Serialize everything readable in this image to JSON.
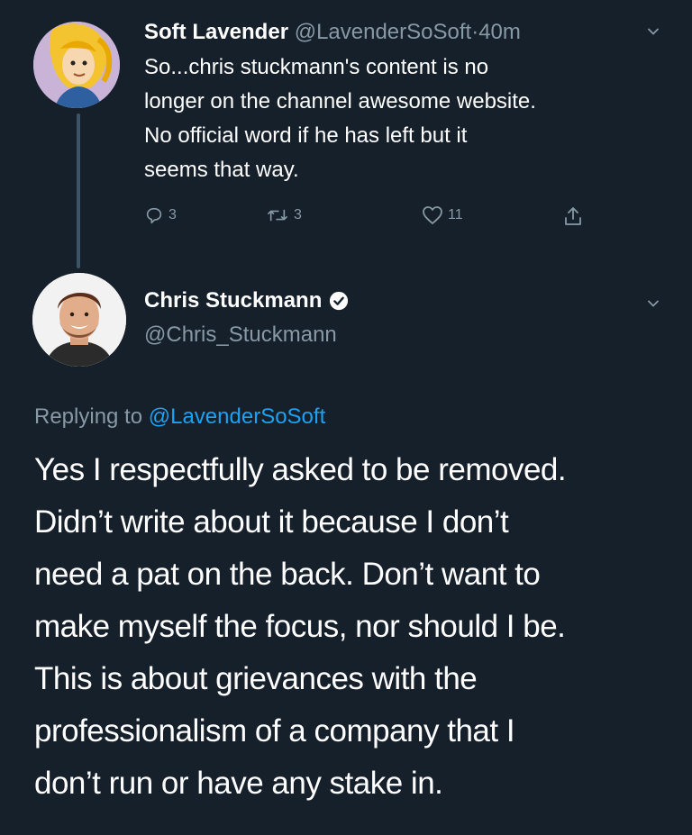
{
  "tweet1": {
    "display_name": "Soft Lavender",
    "handle": "@LavenderSoSoft",
    "separator": "·",
    "time": "40m",
    "text_lines": [
      "So...chris stuckmann's content is no",
      "longer on the channel awesome website.",
      "No official word if he has left but it",
      "seems that way."
    ],
    "reply_count": "3",
    "retweet_count": "3",
    "like_count": "11"
  },
  "tweet2": {
    "display_name": "Chris Stuckmann",
    "handle": "@Chris_Stuckmann",
    "replying_prefix": "Replying to",
    "replying_handle": "@LavenderSoSoft",
    "text_lines": [
      "Yes I respectfully asked to be removed.",
      "Didn’t write about it because I don’t",
      "need a pat on the back. Don’t want to",
      "make myself the focus, nor should I be.",
      "This is about grievances with the",
      "professionalism of a company that I",
      "don’t run or have any stake in."
    ]
  },
  "colors": {
    "background": "#15202b",
    "muted_text": "#8899a6",
    "link": "#1da1f2",
    "thread_line": "#3d5466"
  },
  "icons": {
    "reply": "reply-icon",
    "retweet": "retweet-icon",
    "like": "heart-icon",
    "share": "share-icon",
    "more": "chevron-down-icon",
    "verified": "verified-badge-icon"
  }
}
